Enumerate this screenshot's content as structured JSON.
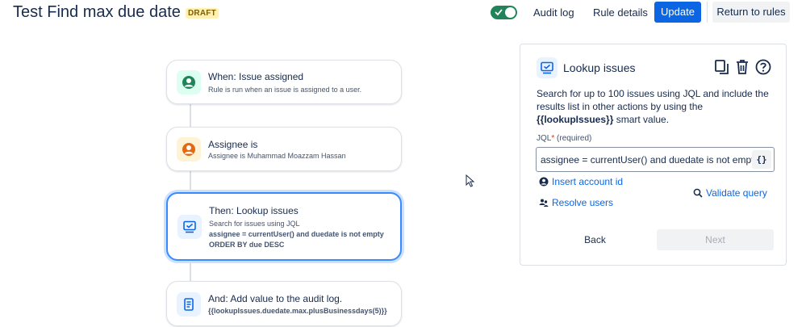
{
  "header": {
    "title": "Test Find max due date",
    "status_badge": "DRAFT",
    "audit_log_label": "Audit log",
    "rule_details_label": "Rule details",
    "update_label": "Update",
    "return_label": "Return to rules",
    "toggle_enabled": true
  },
  "flow": {
    "trigger": {
      "title": "When: Issue assigned",
      "description": "Rule is run when an issue is assigned to a user.",
      "icon": "user-icon",
      "color": "#1f845a"
    },
    "condition": {
      "title": "Assignee is",
      "description": "Assignee is Muhammad Moazzam Hassan",
      "icon": "user-icon",
      "color": "#e56910"
    },
    "action_lookup": {
      "title": "Then: Lookup issues",
      "description": "Search for issues using JQL",
      "query_line1": "assignee = currentUser() and duedate is not empty",
      "query_line2": "ORDER BY due DESC",
      "icon": "monitor-icon",
      "color": "#0c66e4"
    },
    "action_audit": {
      "title": "And: Add value to the audit log.",
      "value": "{{lookupIssues.duedate.max.plusBusinessdays(5)}}",
      "icon": "document-icon",
      "color": "#0c66e4"
    }
  },
  "panel": {
    "title": "Lookup issues",
    "description_pre": "Search for up to 100 issues using JQL and include the results list in other actions by using the ",
    "smart_value": "{{lookupIssues}}",
    "description_post": " smart value.",
    "jql_label": "JQL",
    "jql_required_mark": "*",
    "jql_required_text": "(required)",
    "jql_value": "assignee = currentUser() and duedate is not empty",
    "braces_label": "{}",
    "insert_account_label": "Insert account id",
    "resolve_users_label": "Resolve users",
    "validate_label": "Validate query",
    "back_label": "Back",
    "next_label": "Next"
  },
  "colors": {
    "accent": "#0c66e4",
    "toggle_on": "#1f845a",
    "selected_border": "#388bff"
  }
}
